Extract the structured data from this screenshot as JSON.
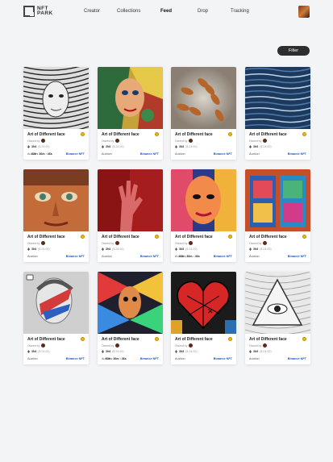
{
  "brand": {
    "line1": "NFT",
    "line2": "PARK"
  },
  "nav": {
    "items": [
      {
        "label": "Creator"
      },
      {
        "label": "Collections"
      },
      {
        "label": "Feed"
      },
      {
        "label": "Drop"
      },
      {
        "label": "Tracking"
      }
    ],
    "active": "Feed"
  },
  "filter_label": "Filter",
  "cards": [
    {
      "title": "Art of Different face",
      "owner_label": "Owned by",
      "price": "3ħ8",
      "price_sub": "($ 24.00)",
      "type": "Auction",
      "market": "Binance NFT",
      "timer": "02h : 36m : 46s",
      "image": "bw-faces"
    },
    {
      "title": "Art of Different face",
      "owner_label": "Owned by",
      "price": "3ħ8",
      "price_sub": "($ 24.00)",
      "type": "Auction",
      "market": "Binance NFT",
      "timer": "",
      "image": "cubist-face"
    },
    {
      "title": "Art of Different face",
      "owner_label": "Owned by",
      "price": "3ħ8",
      "price_sub": "($ 24.00)",
      "type": "Auction",
      "market": "Binance NFT",
      "timer": "",
      "image": "autumn-leaves"
    },
    {
      "title": "Art of Different face",
      "owner_label": "Owned by",
      "price": "3ħ8",
      "price_sub": "($ 24.00)",
      "type": "Auction",
      "market": "Binance NFT",
      "timer": "",
      "image": "ocean-waves"
    },
    {
      "title": "Art of Different face",
      "owner_label": "Owned by",
      "price": "3ħ8",
      "price_sub": "($ 24.00)",
      "type": "Auction",
      "market": "Binance NFT",
      "timer": "",
      "image": "painted-face-closeup"
    },
    {
      "title": "Art of Different face",
      "owner_label": "Owned by",
      "price": "3ħ8",
      "price_sub": "($ 24.00)",
      "type": "Auction",
      "market": "Binance NFT",
      "timer": "",
      "image": "red-hand"
    },
    {
      "title": "Art of Different face",
      "owner_label": "Owned by",
      "price": "3ħ8",
      "price_sub": "($ 24.00)",
      "type": "Auction",
      "market": "Binance NFT",
      "timer": "02h : 36m : 46s",
      "image": "colorful-face"
    },
    {
      "title": "Art of Different face",
      "owner_label": "Owned by",
      "price": "3ħ8",
      "price_sub": "($ 24.00)",
      "type": "Auction",
      "market": "Binance NFT",
      "timer": "",
      "image": "colorful-doors"
    },
    {
      "title": "Art of Different face",
      "owner_label": "Owned by",
      "price": "3ħ8",
      "price_sub": "($ 24.00)",
      "type": "Auction",
      "market": "Binance NFT",
      "timer": "",
      "image": "classical-bust"
    },
    {
      "title": "Art of Different face",
      "owner_label": "Owned by",
      "price": "3ħ8",
      "price_sub": "($ 24.00)",
      "type": "Auction",
      "market": "Binance NFT",
      "timer": "02h : 36m : 46s",
      "image": "geometric-face"
    },
    {
      "title": "Art of Different face",
      "owner_label": "Owned by",
      "price": "3ħ8",
      "price_sub": "($ 24.00)",
      "type": "Auction",
      "market": "Binance NFT",
      "timer": "",
      "image": "red-heart-stained-glass"
    },
    {
      "title": "Art of Different face",
      "owner_label": "Owned by",
      "price": "3ħ8",
      "price_sub": "($ 24.00)",
      "type": "Auction",
      "market": "Binance NFT",
      "timer": "",
      "image": "eye-triangle-sketch"
    }
  ],
  "colors": {
    "accent_link": "#1a56c4",
    "filter_bg": "#2e2e2e",
    "coin": "#f0b90b"
  }
}
